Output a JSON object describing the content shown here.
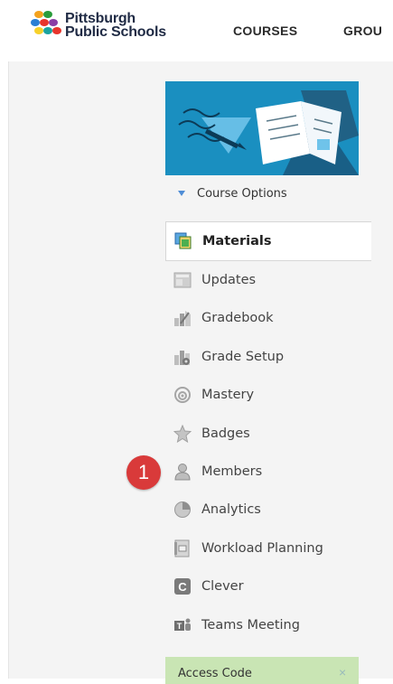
{
  "header": {
    "logo_line1": "Pittsburgh",
    "logo_line2": "Public Schools",
    "nav": [
      "COURSES",
      "GROU"
    ]
  },
  "course": {
    "options_label": "Course Options"
  },
  "menu": {
    "items": [
      {
        "label": "Materials",
        "icon": "materials-icon",
        "active": true
      },
      {
        "label": "Updates",
        "icon": "updates-icon"
      },
      {
        "label": "Gradebook",
        "icon": "gradebook-icon"
      },
      {
        "label": "Grade Setup",
        "icon": "grade-setup-icon"
      },
      {
        "label": "Mastery",
        "icon": "mastery-icon"
      },
      {
        "label": "Badges",
        "icon": "badges-icon"
      },
      {
        "label": "Members",
        "icon": "members-icon"
      },
      {
        "label": "Analytics",
        "icon": "analytics-icon"
      },
      {
        "label": "Workload Planning",
        "icon": "workload-planning-icon"
      },
      {
        "label": "Clever",
        "icon": "clever-icon"
      },
      {
        "label": "Teams Meeting",
        "icon": "teams-meeting-icon"
      }
    ]
  },
  "access_code": {
    "label": "Access Code",
    "close": "×"
  },
  "annotation": {
    "number": "1"
  },
  "colors": {
    "banner": "#1a8fc0",
    "access_bg": "#c9e5b4",
    "annotation": "#d93a3a"
  }
}
